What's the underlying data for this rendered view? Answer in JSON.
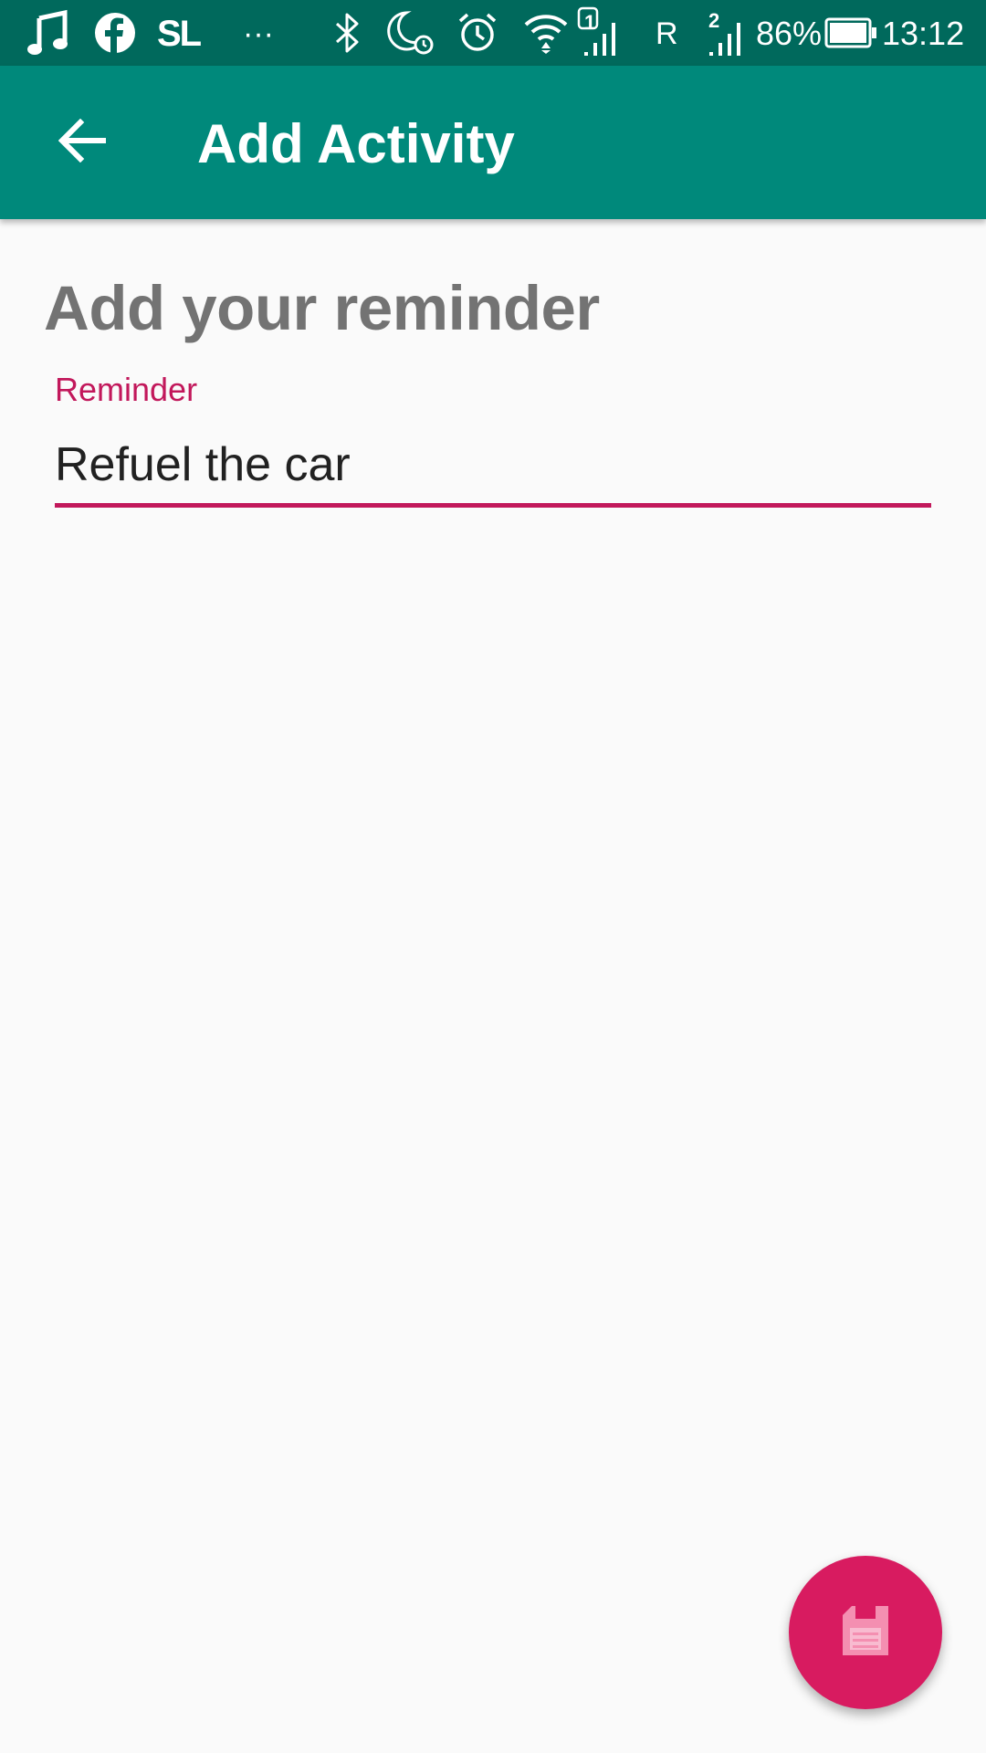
{
  "status_bar": {
    "battery": "86%",
    "time": "13:12",
    "roaming": "R",
    "sim1_label": "1",
    "sim2_label": "2",
    "app_badge": "SL",
    "more_notifications": "···"
  },
  "app_bar": {
    "title": "Add Activity",
    "back_icon": "arrow-back-icon"
  },
  "content": {
    "heading": "Add your reminder",
    "reminder_field": {
      "label": "Reminder",
      "value": "Refuel the car"
    }
  },
  "fab": {
    "icon": "save-icon"
  },
  "colors": {
    "status_bar": "#00695c",
    "app_bar": "#00897b",
    "accent": "#c2185b",
    "fab": "#d81b60",
    "background": "#fafafa",
    "heading_text": "#737373"
  }
}
